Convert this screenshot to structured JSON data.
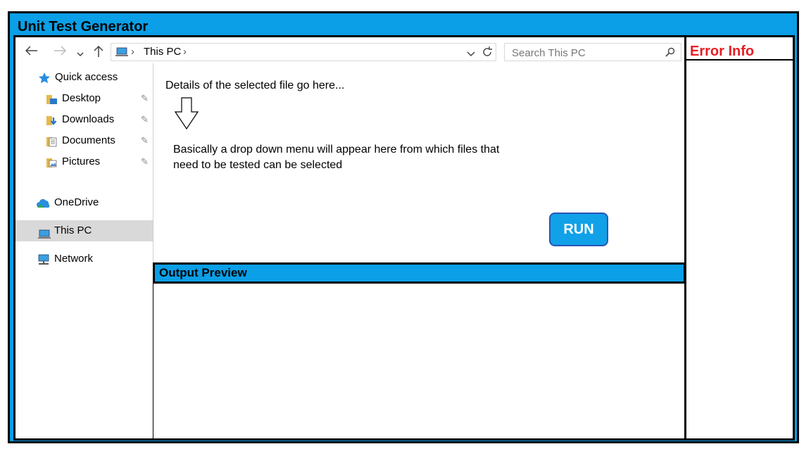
{
  "app": {
    "title": "Unit Test Generator"
  },
  "error_panel": {
    "title": "Error Info",
    "title_color": "#e81e25"
  },
  "toolbar": {
    "back_icon": "arrow-left-icon",
    "forward_icon": "arrow-right-icon",
    "recent_icon": "chevron-down-icon",
    "up_icon": "arrow-up-icon",
    "breadcrumb": [
      "This PC"
    ],
    "search_placeholder": "Search This PC"
  },
  "sidebar": {
    "items": [
      {
        "label": "Quick access",
        "icon": "star-icon"
      },
      {
        "label": "Desktop",
        "icon": "folder-icon",
        "pinned": true
      },
      {
        "label": "Downloads",
        "icon": "download-folder-icon",
        "pinned": true
      },
      {
        "label": "Documents",
        "icon": "documents-folder-icon",
        "pinned": true
      },
      {
        "label": "Pictures",
        "icon": "pictures-folder-icon",
        "pinned": true
      },
      {
        "label": "OneDrive",
        "icon": "cloud-icon"
      },
      {
        "label": "This PC",
        "icon": "computer-icon",
        "selected": true
      },
      {
        "label": "Network",
        "icon": "network-icon"
      }
    ]
  },
  "main": {
    "details_text": "Details of the selected file go here...",
    "dropdown_line1": "Basically a drop down menu will appear here from which files that",
    "dropdown_line2": "need to be tested can be selected",
    "run_label": "RUN",
    "output_title": "Output Preview"
  },
  "colors": {
    "accent": "#0a9fe6",
    "run_button": "#10a1e8",
    "error": "#e81e25"
  }
}
